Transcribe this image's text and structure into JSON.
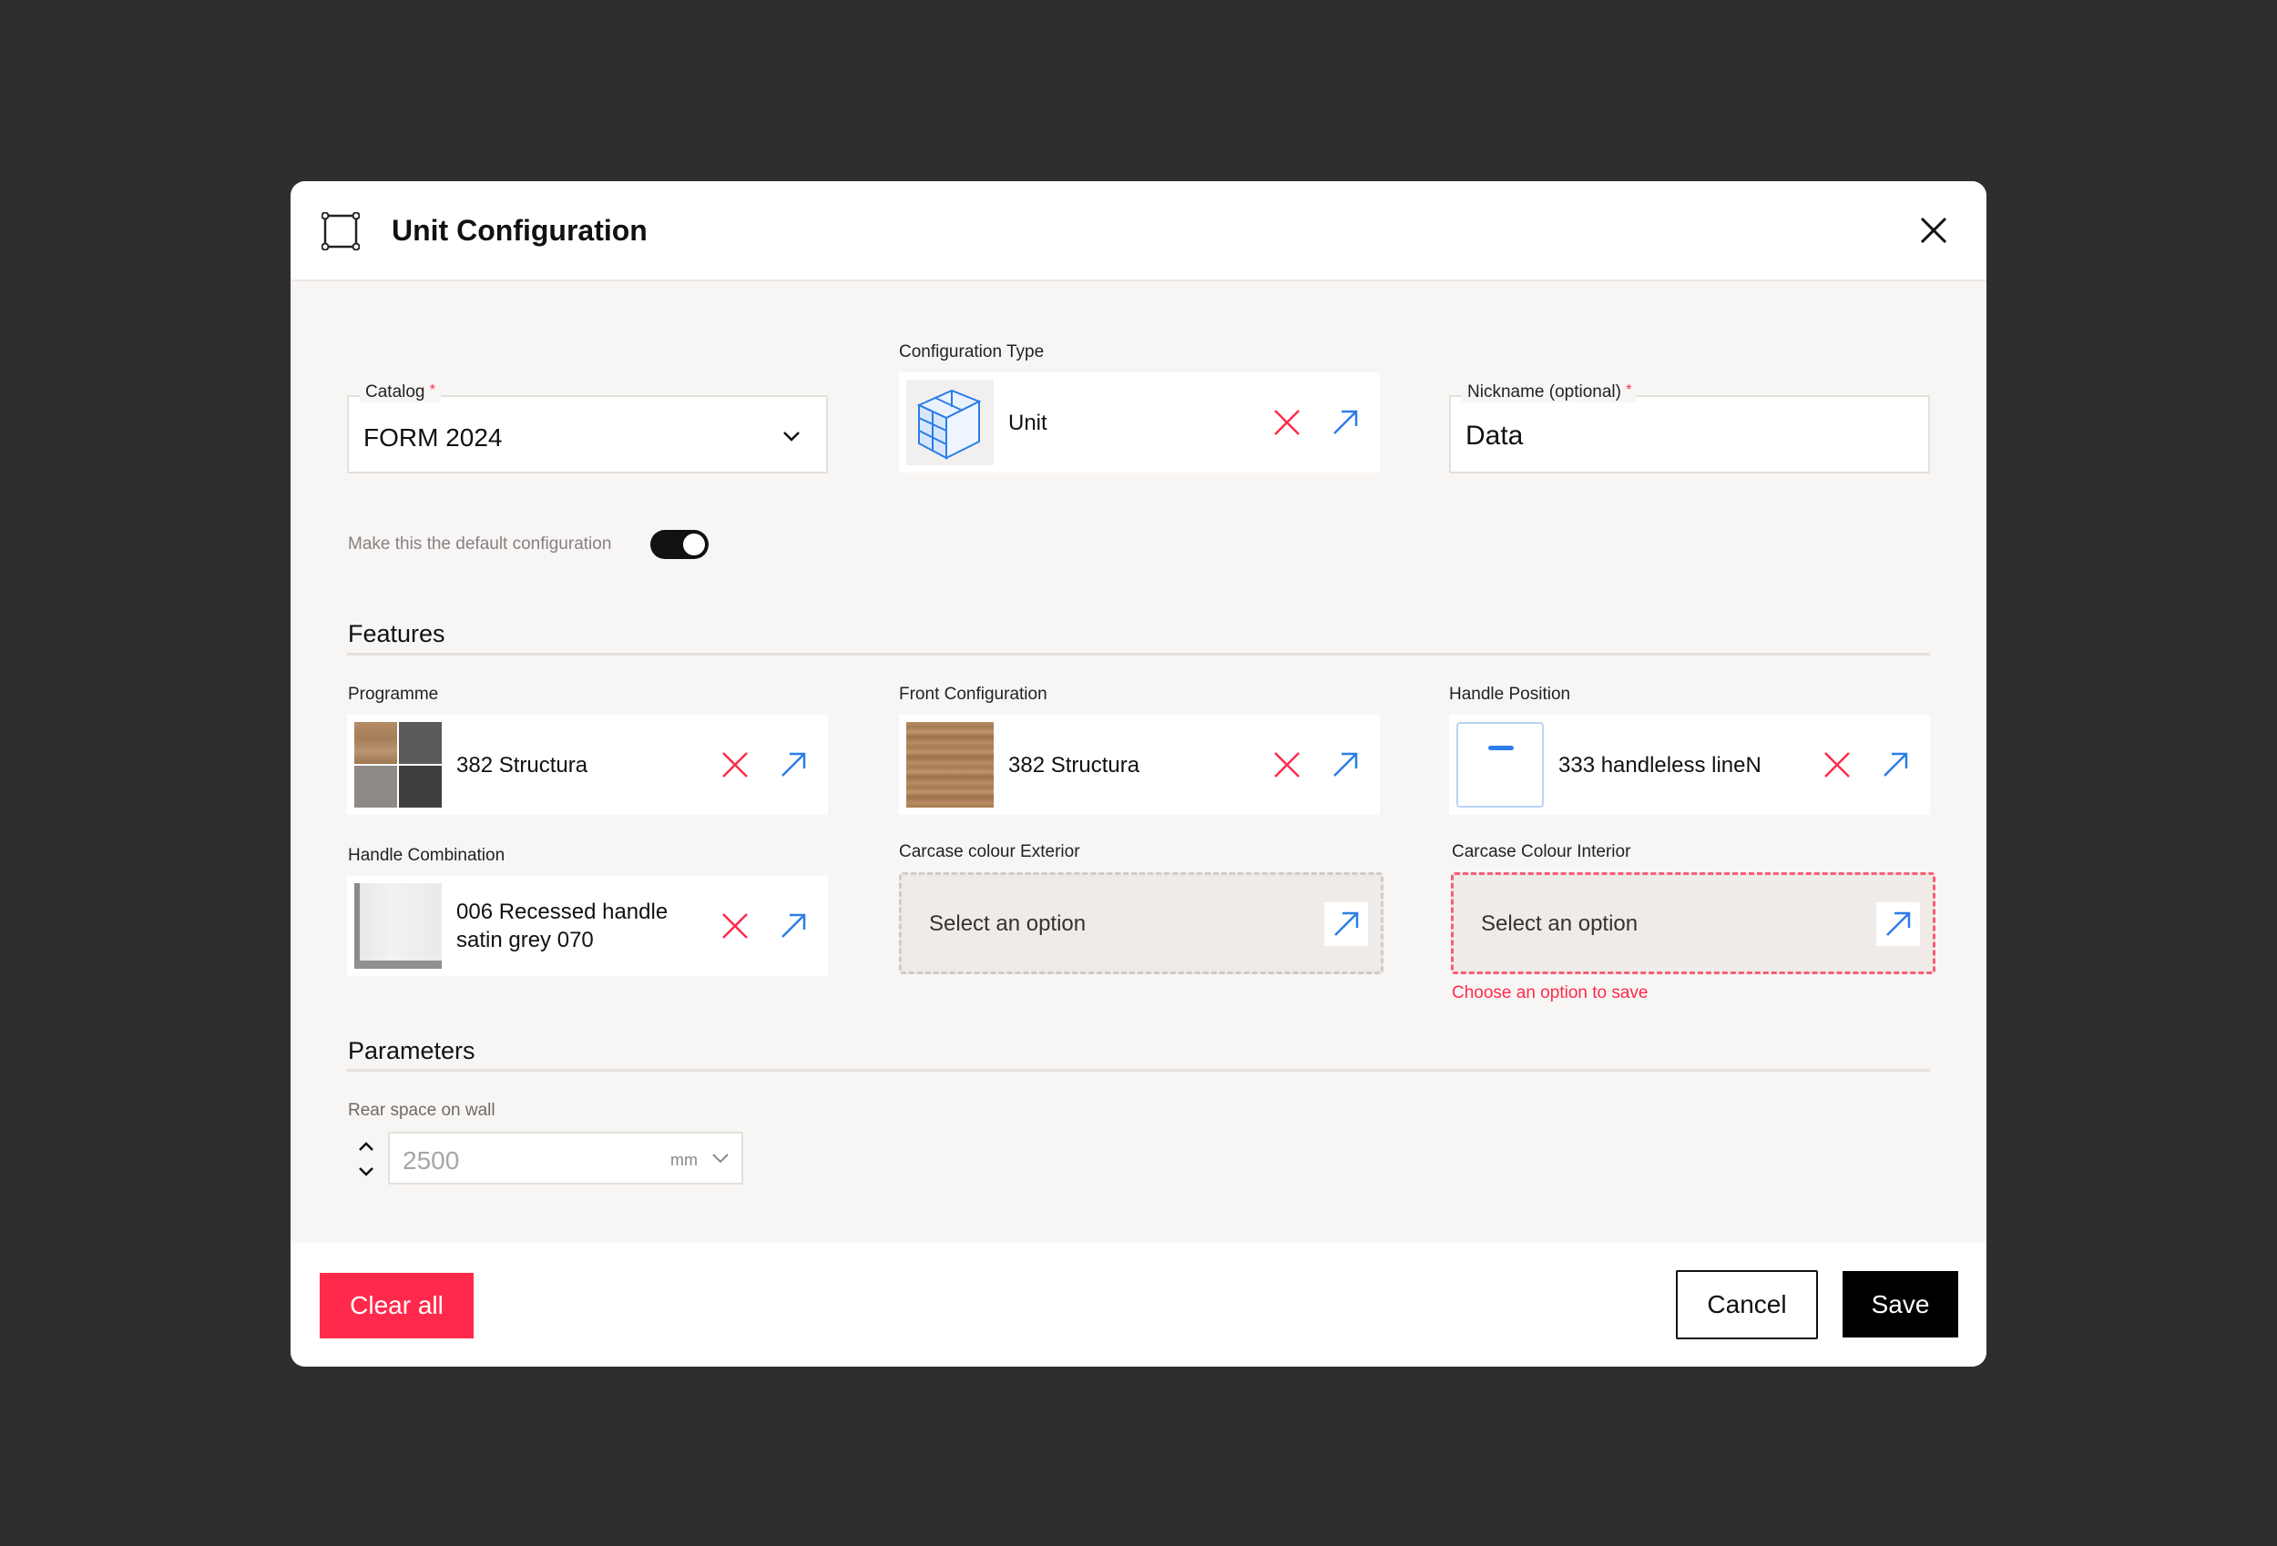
{
  "modal": {
    "title": "Unit Configuration",
    "header_icon": "frame-select-icon",
    "close_icon": "close-icon"
  },
  "catalog": {
    "label": "Catalog",
    "required_mark": "*",
    "value": "FORM 2024"
  },
  "configuration_type": {
    "label": "Configuration Type",
    "value": "Unit",
    "thumb_icon": "cabinet-unit-icon"
  },
  "nickname": {
    "label": "Nickname (optional)",
    "required_mark": "*",
    "value": "Data"
  },
  "default_toggle": {
    "label": "Make this the default configuration",
    "on": true
  },
  "features": {
    "title": "Features",
    "programme": {
      "label": "Programme",
      "value": "382 Structura"
    },
    "front_configuration": {
      "label": "Front Configuration",
      "value": "382 Structura"
    },
    "handle_position": {
      "label": "Handle Position",
      "value": "333 handleless lineN"
    },
    "handle_combination": {
      "label": "Handle Combination",
      "value_line1": "006 Recessed handle",
      "value_line2": "satin grey 070"
    },
    "carcase_exterior": {
      "label": "Carcase colour Exterior",
      "placeholder": "Select an option"
    },
    "carcase_interior": {
      "label": "Carcase Colour Interior",
      "placeholder": "Select an option",
      "error": "Choose an option to save"
    }
  },
  "parameters": {
    "title": "Parameters",
    "rear_space": {
      "label": "Rear space on wall",
      "value": "2500",
      "unit": "mm"
    }
  },
  "footer": {
    "clear_label": "Clear all",
    "cancel_label": "Cancel",
    "save_label": "Save"
  },
  "colors": {
    "accent_red": "#ff2a4b",
    "link_blue": "#2b7de9",
    "background_dark": "#2f2d2e",
    "panel": "#f8f6f4"
  }
}
